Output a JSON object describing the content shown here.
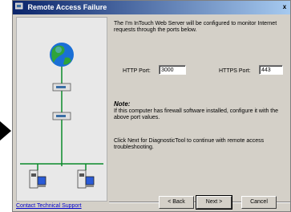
{
  "window": {
    "title": "Remote Access Failure",
    "close_glyph": "x"
  },
  "content": {
    "intro_text": "The I'm InTouch Web Server will be configured to monitor Internet requests through the ports below.",
    "http_label": "HTTP Port:",
    "http_value": "3000",
    "https_label": "HTTPS Port:",
    "https_value": "443",
    "note_title": "Note:",
    "note_text": "If this computer has firewall software installed, configure it with the above port values.",
    "next_text": "Click Next for DiagnosticTool to continue with remote access troubleshooting."
  },
  "footer": {
    "support_link": "Contact Technical Support",
    "back_label": "< Back",
    "next_label": "Next >",
    "cancel_label": "Cancel"
  },
  "icons": [
    "globe-icon",
    "server-icon",
    "computer-icon"
  ]
}
